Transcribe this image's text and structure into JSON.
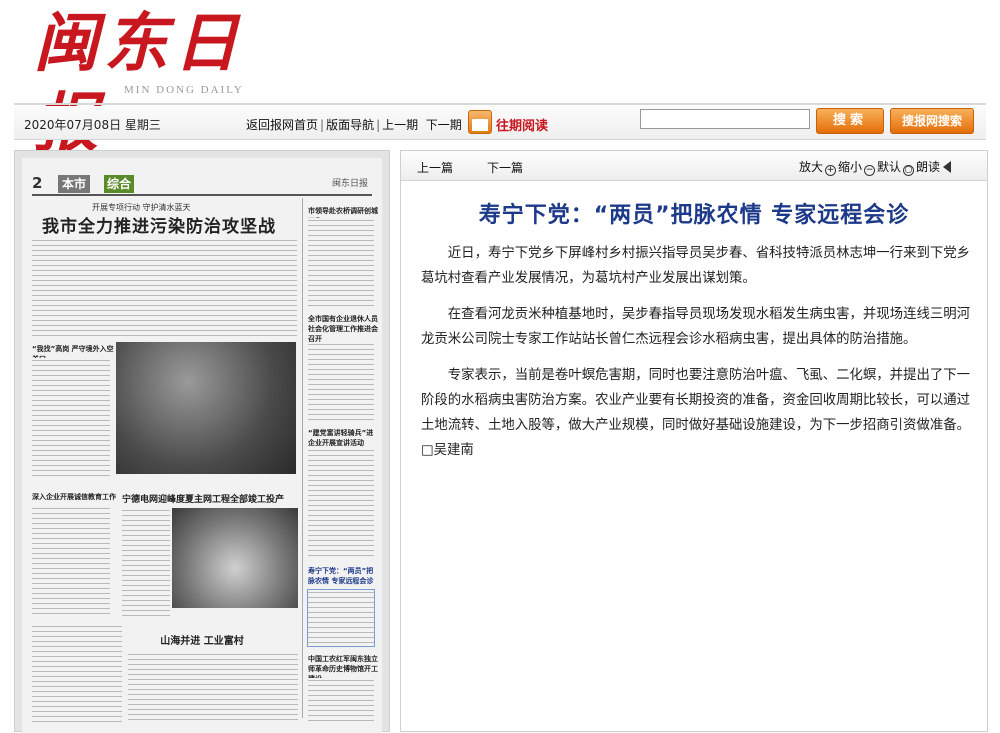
{
  "brand": {
    "name_cn": "闽东日报",
    "name_en": "MIN DONG DAILY"
  },
  "navbar": {
    "date": "2020年07月08日 星期三",
    "links": [
      "返回报网首页",
      "版面导航",
      "上一期",
      "下一期"
    ],
    "separator": "|",
    "archive_label": "往期阅读",
    "search_placeholder": "",
    "search_button": "搜索",
    "site_search_button": "搜报网搜索"
  },
  "page": {
    "number": "2",
    "section": "本市",
    "section_tag": "综合",
    "masthead": "闽东日报",
    "kicker": "开展专项行动 守护清水蓝天",
    "headline": "我市全力推进污染防治攻坚战",
    "side_stories": [
      "市领导赴农桥调研创城工作",
      "全市国有企业退休人员社会化管理工作推进会召开",
      "“建党富讲轻骑兵”进企业开展宣讲活动",
      "寿宁下党：“两员”把脉农情 专家远程会诊",
      "中国工农红军闽东独立师革命历史博物馆开工建设"
    ],
    "sub_stories": [
      "“我找”高岗 严守境外入空关口",
      "深入企业开展诚信教育工作",
      "宁德电网迎峰度夏主网工程全部竣工投产",
      "山海并进 工业富村"
    ]
  },
  "article": {
    "prev": "上一篇",
    "next": "下一篇",
    "tools": {
      "zoom_in": "放大",
      "zoom_out": "缩小",
      "default": "默认",
      "read": "朗读"
    },
    "title": "寿宁下党：“两员”把脉农情 专家远程会诊",
    "paragraphs": [
      "近日，寿宁下党乡下屏峰村乡村振兴指导员吴步春、省科技特派员林志坤一行来到下党乡葛坑村查看产业发展情况，为葛坑村产业发展出谋划策。",
      "在查看河龙贡米种植基地时，吴步春指导员现场发现水稻发生病虫害，并现场连线三明河龙贡米公司院士专家工作站站长曾仁杰远程会诊水稻病虫害，提出具体的防治措施。",
      "专家表示，当前是卷叶螟危害期，同时也要注意防治叶瘟、飞虱、二化螟，并提出了下一阶段的水稻病虫害防治方案。农业产业要有长期投资的准备，资金回收周期比较长，可以通过土地流转、土地入股等，做大产业规模，同时做好基础设施建设，为下一步招商引资做准备。□吴建南"
    ]
  }
}
